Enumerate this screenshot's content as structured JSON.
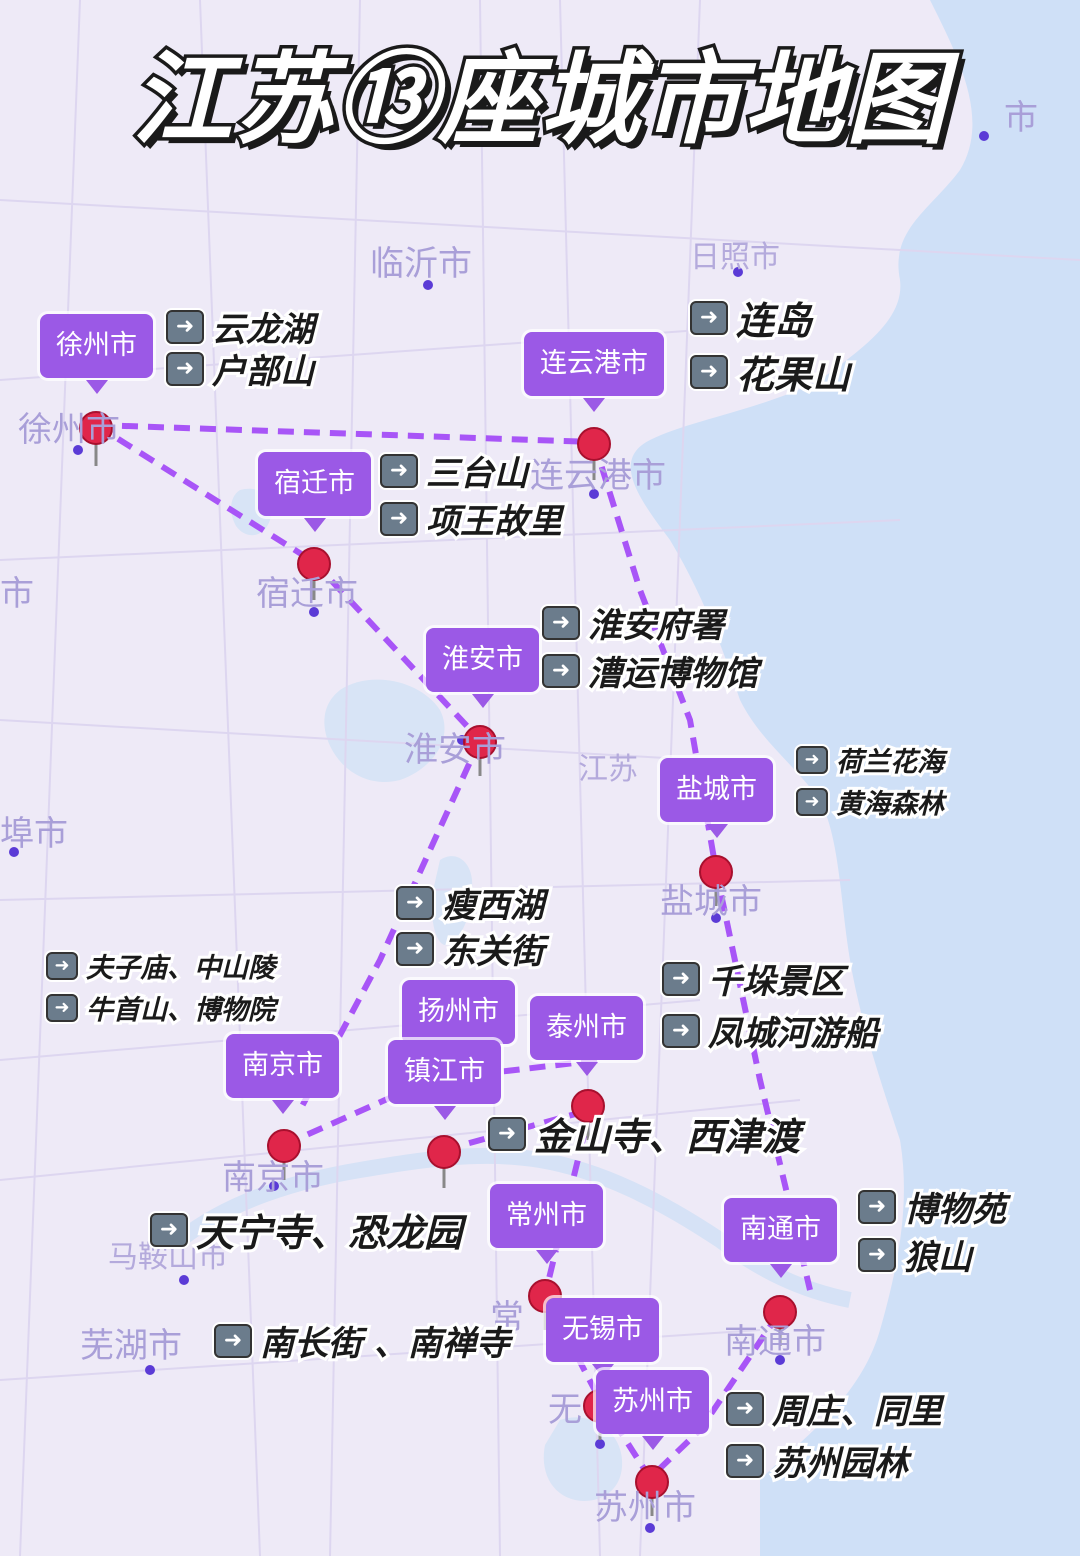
{
  "title": "江苏⑬座城市地图",
  "colors": {
    "water": "#cfe0f7",
    "land": "#eeeaf7",
    "route": "#a855f7",
    "tag": "#9b59e6",
    "pin": "#e0264a"
  },
  "map_labels": [
    {
      "id": "linyi",
      "text": "临沂市"
    },
    {
      "id": "rizhao",
      "text": "日照市"
    },
    {
      "id": "xuzhou",
      "text": "徐州市"
    },
    {
      "id": "lianyungang",
      "text": "连云港市"
    },
    {
      "id": "suqian",
      "text": "宿迁市"
    },
    {
      "id": "huaian",
      "text": "淮安市"
    },
    {
      "id": "jiangsu",
      "text": "江苏"
    },
    {
      "id": "yancheng",
      "text": "盐城市"
    },
    {
      "id": "nanjing",
      "text": "南京市"
    },
    {
      "id": "maanshan",
      "text": "马鞍山市"
    },
    {
      "id": "wuhu",
      "text": "芜湖市"
    },
    {
      "id": "nantong",
      "text": "南通市"
    },
    {
      "id": "suzhou",
      "text": "苏州市"
    },
    {
      "id": "wuxi",
      "text": "无"
    },
    {
      "id": "chang",
      "text": "常"
    },
    {
      "id": "left1",
      "text": "市"
    },
    {
      "id": "left2",
      "text": "埠市"
    },
    {
      "id": "topright",
      "text": "市"
    }
  ],
  "cities": [
    {
      "id": "xuzhou",
      "name": "徐州市",
      "attractions": [
        "云龙湖",
        "户部山"
      ]
    },
    {
      "id": "lianyungang",
      "name": "连云港市",
      "attractions": [
        "连岛",
        "花果山"
      ]
    },
    {
      "id": "suqian",
      "name": "宿迁市",
      "attractions": [
        "三台山",
        "项王故里"
      ]
    },
    {
      "id": "huaian",
      "name": "淮安市",
      "attractions": [
        "淮安府署",
        "漕运博物馆"
      ]
    },
    {
      "id": "yancheng",
      "name": "盐城市",
      "attractions": [
        "荷兰花海",
        "黄海森林"
      ]
    },
    {
      "id": "yangzhou",
      "name": "扬州市",
      "attractions": [
        "瘦西湖",
        "东关街"
      ]
    },
    {
      "id": "taizhou",
      "name": "泰州市",
      "attractions": [
        "千垛景区",
        "凤城河游船"
      ]
    },
    {
      "id": "nanjing",
      "name": "南京市",
      "attractions": [
        "夫子庙、中山陵",
        "牛首山、博物院"
      ]
    },
    {
      "id": "zhenjiang",
      "name": "镇江市",
      "attractions": [
        "金山寺、西津渡"
      ]
    },
    {
      "id": "changzhou",
      "name": "常州市",
      "attractions": [
        "天宁寺、恐龙园"
      ]
    },
    {
      "id": "wuxi",
      "name": "无锡市",
      "attractions": [
        "南长街 、南禅寺"
      ]
    },
    {
      "id": "nantong",
      "name": "南通市",
      "attractions": [
        "博物苑",
        "狼山"
      ]
    },
    {
      "id": "suzhou",
      "name": "苏州市",
      "attractions": [
        "周庄、同里",
        "苏州园林"
      ]
    }
  ]
}
